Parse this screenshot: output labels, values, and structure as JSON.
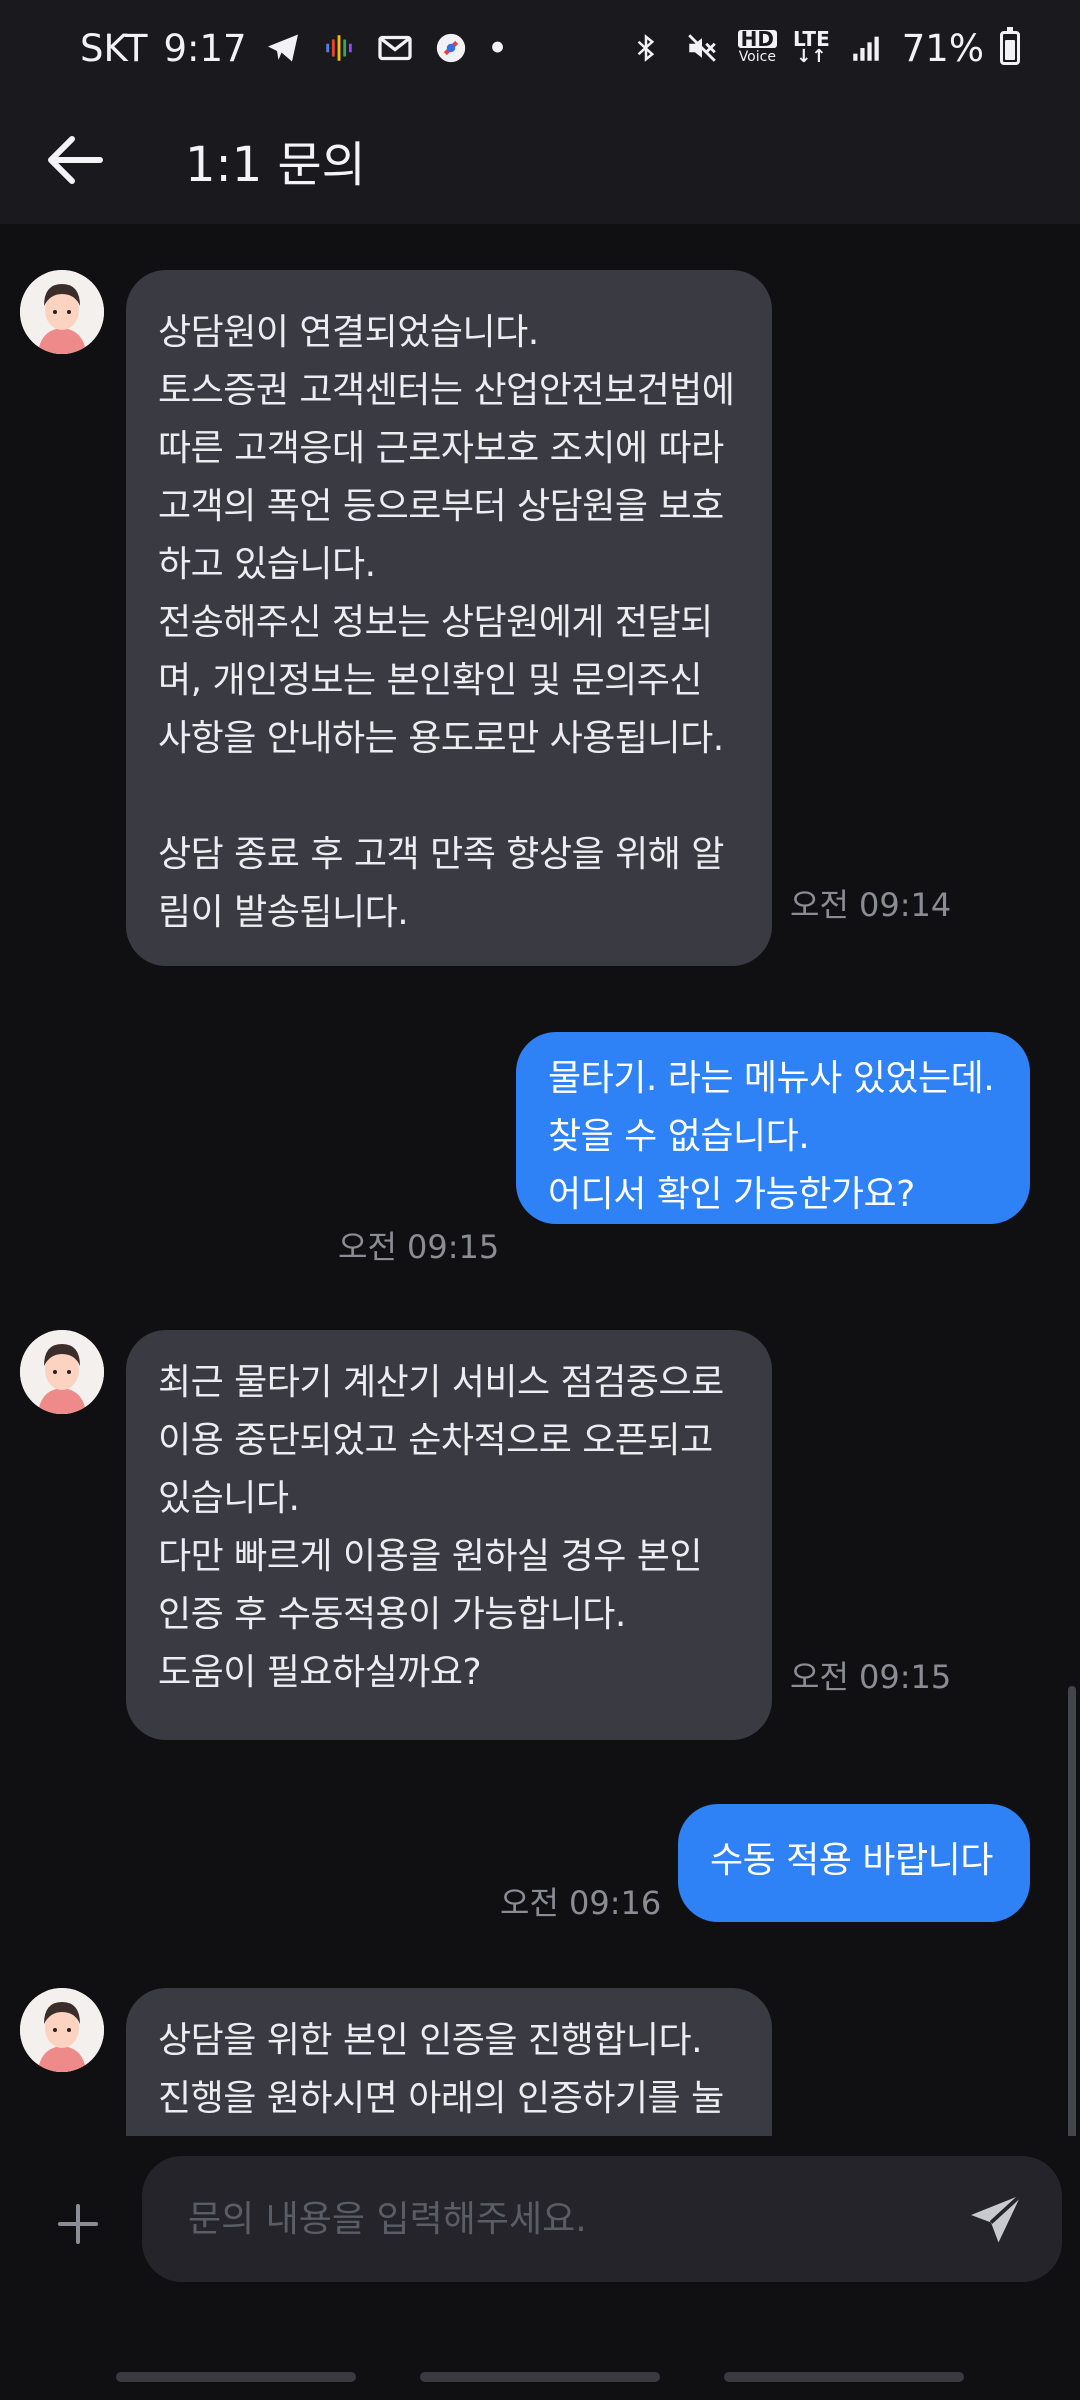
{
  "status_bar": {
    "carrier": "SKT",
    "time": "9:17",
    "notification_dot": "•",
    "hd_label": "HD",
    "voice_label": "Voice",
    "lte_label": "LTE",
    "battery": "71%",
    "battery_level": 0.71
  },
  "header": {
    "title": "1:1 문의"
  },
  "messages": [
    {
      "sender": "agent",
      "text": "상담원이 연결되었습니다.\n토스증권 고객센터는 산업안전보건법에 따른 고객응대 근로자보호 조치에 따라 고객의 폭언 등으로부터 상담원을 보호하고 있습니다.\n전송해주신 정보는 상담원에게 전달되며, 개인정보는 본인확인 및 문의주신 사항을 안내하는 용도로만 사용됩니다.\n\n상담 종료 후 고객 만족 향상을 위해 알림이 발송됩니다.",
      "time": "오전 09:14"
    },
    {
      "sender": "user",
      "text": "물타기. 라는 메뉴사 있었는데.\n찾을 수 없습니다.\n어디서 확인 가능한가요?",
      "time": "오전 09:15"
    },
    {
      "sender": "agent",
      "text": "최근 물타기 계산기 서비스 점검중으로 이용 중단되었고 순차적으로 오픈되고 있습니다.\n다만 빠르게 이용을 원하실 경우 본인 인증 후 수동적용이 가능합니다.\n도움이 필요하실까요?",
      "time": "오전 09:15"
    },
    {
      "sender": "user",
      "text": "수동 적용 바랍니다",
      "time": "오전 09:16"
    },
    {
      "sender": "agent",
      "text": "상담을 위한 본인 인증을 진행합니다.\n진행을 원하시면 아래의 인증하기를 눌",
      "time": ""
    }
  ],
  "composer": {
    "placeholder": "문의 내용을 입력해주세요.",
    "value": ""
  },
  "colors": {
    "user_bubble": "#2f82f5",
    "agent_bubble": "#3a3a42",
    "background": "#101013"
  }
}
